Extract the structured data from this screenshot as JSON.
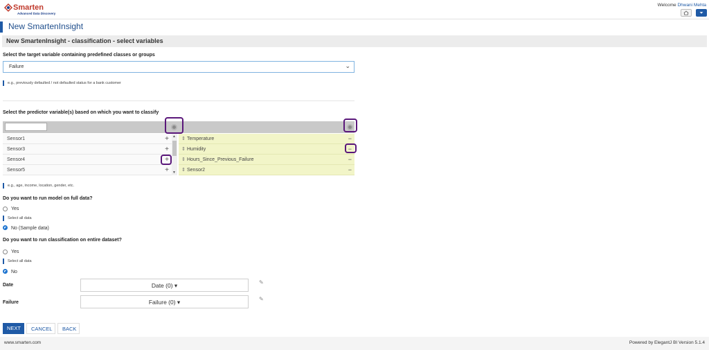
{
  "brand": {
    "name": "Smarten",
    "tagline": "Advanced Data Discovery"
  },
  "header": {
    "welcome_prefix": "Welcome",
    "user": "Dhwani Mehta"
  },
  "window_title": "New SmartenInsight",
  "section_title": "New SmartenInsight - classification - select variables",
  "target": {
    "label": "Select the target variable containing predefined classes or groups",
    "selected": "Failure",
    "hint": "e.g., previously defaulted / not defaulted status for a bank customer"
  },
  "predictors": {
    "label": "Select the predictor variable(s) based on which you want to classify",
    "available": [
      "Sensor1",
      "Sensor3",
      "Sensor4",
      "Sensor5"
    ],
    "selected": [
      "Temperature",
      "Humidity",
      "Hours_Since_Previous_Failure",
      "Sensor2"
    ],
    "hint": "e.g., age, income, location, gender, etc."
  },
  "full_data": {
    "question": "Do you want to run model on full data?",
    "yes": "Yes",
    "yes_hint": "Select all data",
    "no": "No (Sample data)",
    "selected": "no"
  },
  "entire_dataset": {
    "question": "Do you want to run classification on entire dataset?",
    "yes": "Yes",
    "yes_hint": "Select all data",
    "no": "No",
    "selected": "no"
  },
  "filters": [
    {
      "label": "Date",
      "value": "Date (0)"
    },
    {
      "label": "Failure",
      "value": "Failure (0)"
    }
  ],
  "buttons": {
    "next": "NEXT",
    "cancel": "CANCEL",
    "back": "BACK"
  },
  "footer": {
    "left": "www.smarten.com",
    "right": "Powered by ElegantJ BI Version 5.1.4"
  },
  "colors": {
    "accent": "#1f5aa6",
    "selected_bg": "#f2f5c8",
    "highlight_ring": "#5a177a"
  },
  "icons": {
    "home": "home-icon",
    "menu": "menu-caret-icon",
    "gear": "gear-icon",
    "add": "plus-icon",
    "remove": "minus-icon",
    "eraser": "eraser-icon",
    "drag": "drag-handle-icon"
  }
}
